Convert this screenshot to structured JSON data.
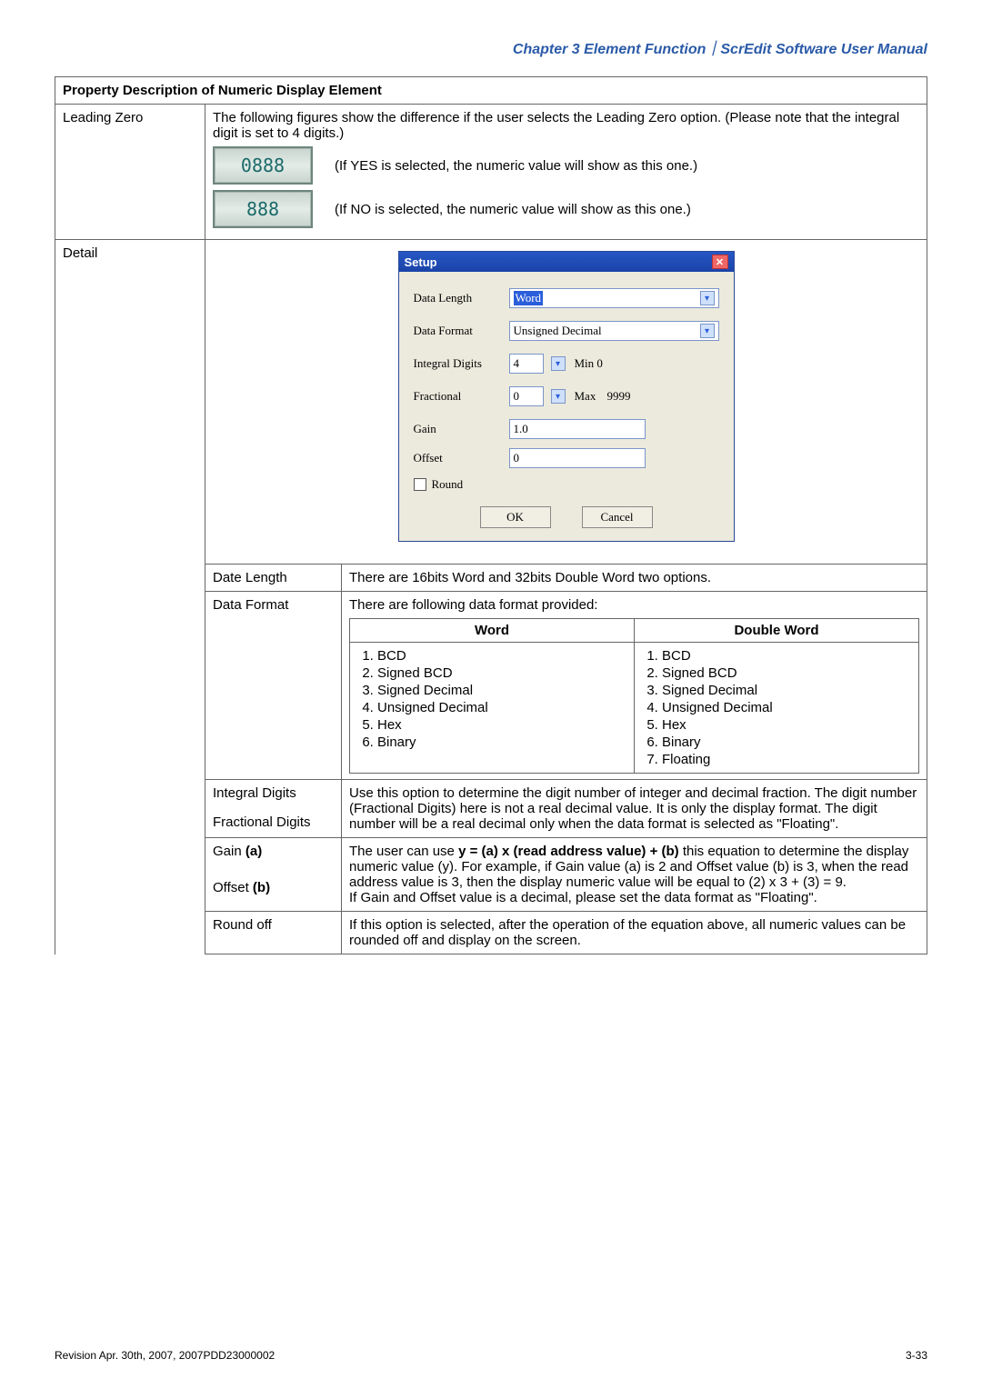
{
  "chapter_head": "Chapter 3  Element Function｜ScrEdit Software User Manual",
  "table_title": "Property Description of Numeric Display Element",
  "leading_zero": {
    "label": "Leading Zero",
    "intro": "The following figures show the difference if the user selects the Leading Zero option. (Please note that the integral digit is set to 4 digits.)",
    "fig_yes_num": "0888",
    "fig_yes_cap": "(If YES is selected, the numeric value will show as this one.)",
    "fig_no_num": "888",
    "fig_no_cap": "(If NO is selected, the numeric value will show as this one.)"
  },
  "detail_label": "Detail",
  "setup": {
    "title": "Setup",
    "data_length_lbl": "Data Length",
    "data_length_val": "Word",
    "data_format_lbl": "Data Format",
    "data_format_val": "Unsigned Decimal",
    "int_lbl": "Integral Digits",
    "int_val": "4",
    "min_lbl": "Min 0",
    "frac_lbl": "Fractional",
    "frac_val": "0",
    "max_lbl": "Max",
    "max_val": "9999",
    "gain_lbl": "Gain",
    "gain_val": "1.0",
    "offset_lbl": "Offset",
    "offset_val": "0",
    "round_lbl": "Round",
    "ok": "OK",
    "cancel": "Cancel"
  },
  "rows": {
    "date_length_lbl": "Date Length",
    "date_length_txt": "There are 16bits Word and 32bits Double Word two options.",
    "data_format_lbl": "Data Format",
    "data_format_txt": "There are following data format provided:",
    "fmt_head_word": "Word",
    "fmt_head_dword": "Double Word",
    "fmt_word": [
      "BCD",
      "Signed BCD",
      "Signed Decimal",
      "Unsigned Decimal",
      "Hex",
      "Binary"
    ],
    "fmt_dword": [
      "BCD",
      "Signed BCD",
      "Signed Decimal",
      "Unsigned Decimal",
      "Hex",
      "Binary",
      "Floating"
    ],
    "intdig_lbl": "Integral Digits",
    "fracdig_lbl": "Fractional Digits",
    "digits_txt": "Use this option to determine the digit number of integer and decimal fraction. The digit number (Fractional Digits) here is not a real decimal value. It is only the display format. The digit number will be a real decimal only when the data format is selected as \"Floating\".",
    "gain_lbl_pre": "Gain ",
    "gain_lbl_bold": "(a)",
    "offset_lbl_pre": "Offset ",
    "offset_lbl_bold": "(b)",
    "gain_txt_1": "The user can use ",
    "gain_txt_bold": "y = (a) x (read address value) + (b)",
    "gain_txt_2": " this equation to determine the display numeric value (y). For example, if Gain value (a) is 2 and Offset value (b) is 3, when the read address value is 3, then the display numeric value will be equal to (2)  x 3 + (3)  =  9.",
    "gain_txt_3": "If Gain and Offset value is a decimal, please set the data format as \"Floating\".",
    "round_lbl": "Round off",
    "round_txt": "If this option is selected, after the operation of the equation above, all numeric values can be rounded off and display on the screen."
  },
  "footer_left": "Revision Apr. 30th, 2007, 2007PDD23000002",
  "footer_right": "3-33"
}
